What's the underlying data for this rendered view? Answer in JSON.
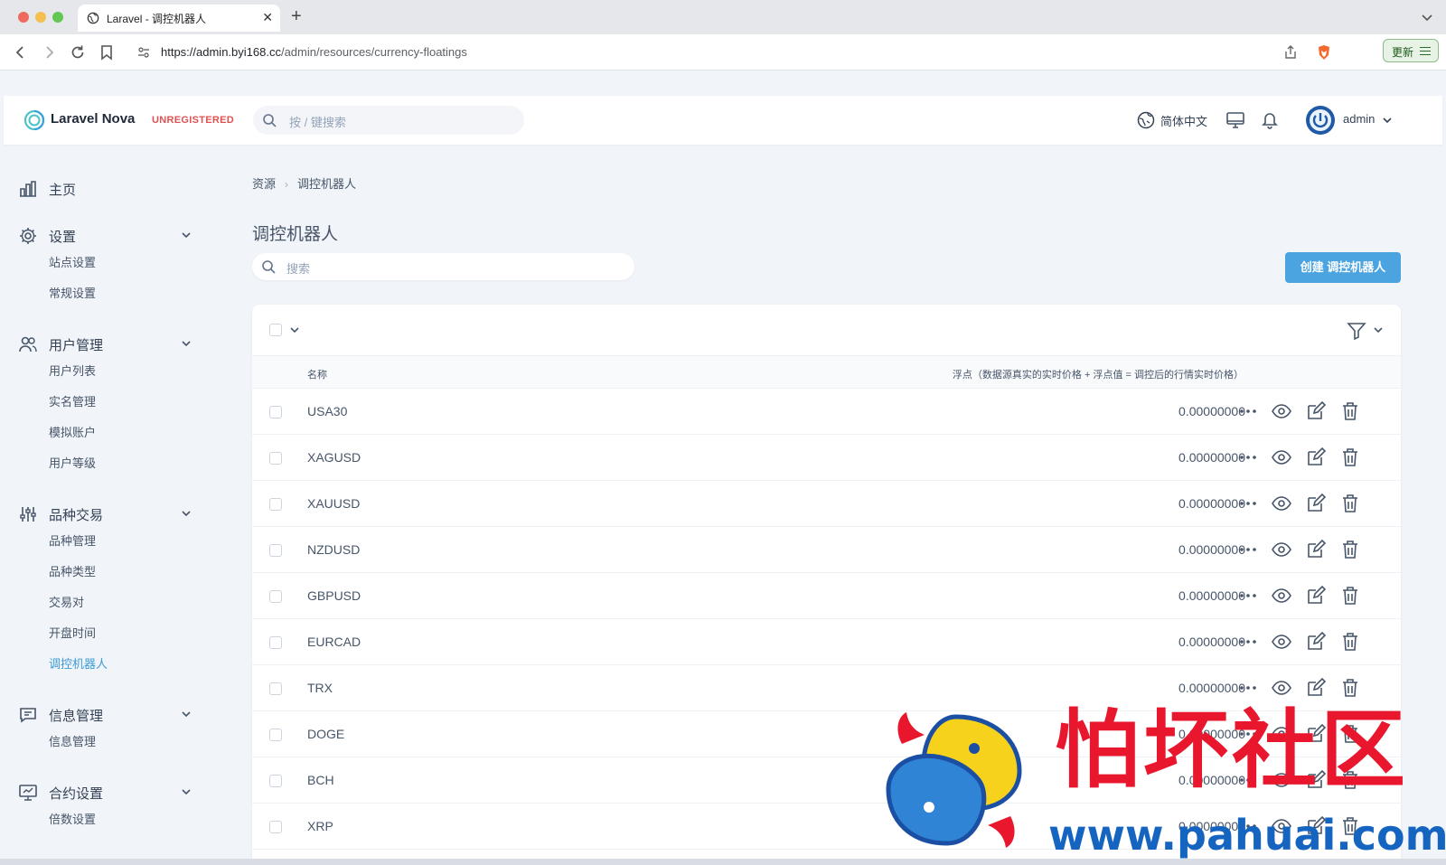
{
  "browser": {
    "tab_title": "Laravel - 调控机器人",
    "url_host": "https://admin.byi168.cc",
    "url_path": "/admin/resources/currency-floatings",
    "update_label": "更新"
  },
  "header": {
    "brand": "Laravel Nova",
    "badge": "UNREGISTERED",
    "search_placeholder": "按 / 键搜索",
    "language": "简体中文",
    "user": "admin"
  },
  "sidebar": {
    "home": "主页",
    "groups": [
      {
        "label": "设置",
        "items": [
          "站点设置",
          "常规设置"
        ]
      },
      {
        "label": "用户管理",
        "items": [
          "用户列表",
          "实名管理",
          "模拟账户",
          "用户等级"
        ]
      },
      {
        "label": "品种交易",
        "items": [
          "品种管理",
          "品种类型",
          "交易对",
          "开盘时间",
          "调控机器人"
        ]
      },
      {
        "label": "信息管理",
        "items": [
          "信息管理"
        ]
      },
      {
        "label": "合约设置",
        "items": [
          "倍数设置"
        ]
      }
    ],
    "active_item": "调控机器人"
  },
  "main": {
    "breadcrumb": [
      "资源",
      "调控机器人"
    ],
    "title": "调控机器人",
    "search_placeholder": "搜索",
    "create_label": "创建 调控机器人",
    "columns": {
      "name": "名称",
      "float": "浮点（数据源真实的实时价格 + 浮点值 = 调控后的行情实时价格）"
    },
    "rows": [
      {
        "name": "USA30",
        "value": "0.00000000"
      },
      {
        "name": "XAGUSD",
        "value": "0.00000000"
      },
      {
        "name": "XAUUSD",
        "value": "0.00000000"
      },
      {
        "name": "NZDUSD",
        "value": "0.00000000"
      },
      {
        "name": "GBPUSD",
        "value": "0.00000000"
      },
      {
        "name": "EURCAD",
        "value": "0.00000000"
      },
      {
        "name": "TRX",
        "value": "0.00000000"
      },
      {
        "name": "DOGE",
        "value": "0.00000000"
      },
      {
        "name": "BCH",
        "value": "0.00000000"
      },
      {
        "name": "XRP",
        "value": "0.00000000"
      }
    ]
  },
  "watermark": {
    "text": "怕坏社区",
    "url": "www.pahuai.com"
  },
  "colors": {
    "accent": "#4ba3e0",
    "active_link": "#3d9bd6",
    "badge": "#e05252",
    "watermark_red": "#e8172e",
    "watermark_blue": "#1565c0"
  }
}
